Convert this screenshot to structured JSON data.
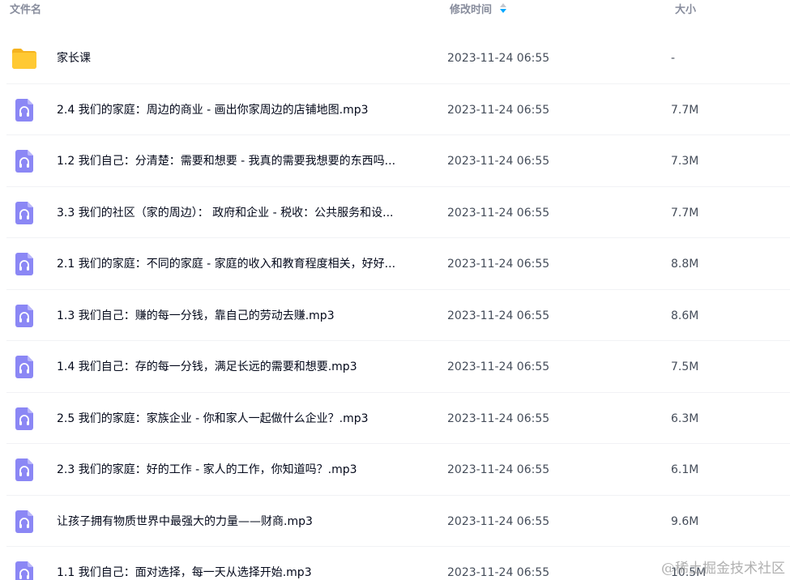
{
  "header": {
    "name_label": "文件名",
    "time_label": "修改时间",
    "size_label": "大小"
  },
  "files": [
    {
      "type": "folder",
      "icon": "folder-icon",
      "name": "家长课",
      "time": "2023-11-24 06:55",
      "size": "-"
    },
    {
      "type": "audio",
      "icon": "audio-file-icon",
      "name": "2.4 我们的家庭：周边的商业 - 画出你家周边的店铺地图.mp3",
      "time": "2023-11-24 06:55",
      "size": "7.7M"
    },
    {
      "type": "audio",
      "icon": "audio-file-icon",
      "name": "1.2 我们自己：分清楚：需要和想要 - 我真的需要我想要的东西吗...",
      "time": "2023-11-24 06:55",
      "size": "7.3M"
    },
    {
      "type": "audio",
      "icon": "audio-file-icon",
      "name": "3.3 我们的社区（家的周边）： 政府和企业 - 税收：公共服务和设...",
      "time": "2023-11-24 06:55",
      "size": "7.7M"
    },
    {
      "type": "audio",
      "icon": "audio-file-icon",
      "name": "2.1 我们的家庭：不同的家庭 - 家庭的收入和教育程度相关，好好...",
      "time": "2023-11-24 06:55",
      "size": "8.8M"
    },
    {
      "type": "audio",
      "icon": "audio-file-icon",
      "name": "1.3 我们自己：赚的每一分钱，靠自己的劳动去赚.mp3",
      "time": "2023-11-24 06:55",
      "size": "8.6M"
    },
    {
      "type": "audio",
      "icon": "audio-file-icon",
      "name": "1.4 我们自己：存的每一分钱，满足长远的需要和想要.mp3",
      "time": "2023-11-24 06:55",
      "size": "7.5M"
    },
    {
      "type": "audio",
      "icon": "audio-file-icon",
      "name": "2.5 我们的家庭：家族企业 - 你和家人一起做什么企业？.mp3",
      "time": "2023-11-24 06:55",
      "size": "6.3M"
    },
    {
      "type": "audio",
      "icon": "audio-file-icon",
      "name": "2.3 我们的家庭：好的工作 - 家人的工作，你知道吗？.mp3",
      "time": "2023-11-24 06:55",
      "size": "6.1M"
    },
    {
      "type": "audio",
      "icon": "audio-file-icon",
      "name": "让孩子拥有物质世界中最强大的力量——财商.mp3",
      "time": "2023-11-24 06:55",
      "size": "9.6M"
    },
    {
      "type": "audio",
      "icon": "audio-file-icon",
      "name": "1.1 我们自己：面对选择，每一天从选择开始.mp3",
      "time": "2023-11-24 06:55",
      "size": "10.5M"
    }
  ],
  "watermark": "@稀土掘金技术社区",
  "colors": {
    "folder": "#ffc933",
    "audio_icon": "#8b87f5",
    "sort_active": "#06a7ff"
  }
}
